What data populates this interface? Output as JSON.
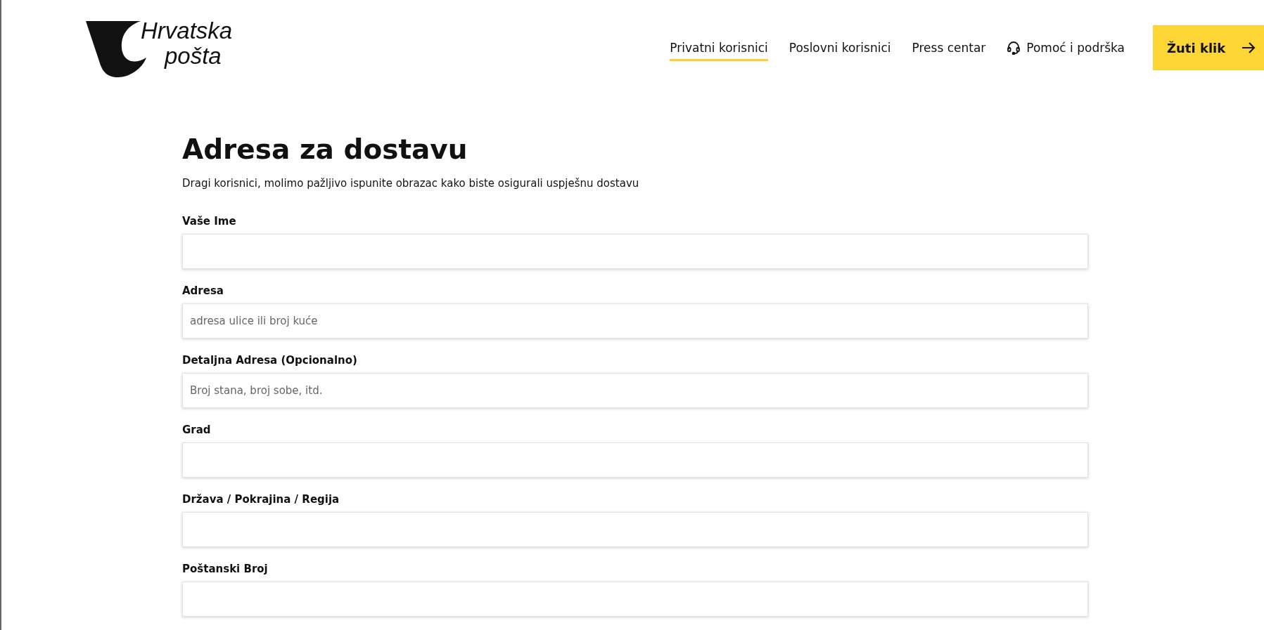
{
  "logo": {
    "line_1": "Hrvatska",
    "line_2": "pošta"
  },
  "nav": [
    {
      "label": "Privatni korisnici",
      "selected": true,
      "kind": "link"
    },
    {
      "label": "Poslovni korisnici",
      "selected": false,
      "kind": "link"
    },
    {
      "label": "Press centar",
      "selected": false,
      "kind": "link"
    },
    {
      "label": "Pomoć i podrška",
      "selected": false,
      "kind": "support"
    }
  ],
  "cta": {
    "label": "Žuti klik"
  },
  "heading": "Adresa za dostavu",
  "intro": "Dragi korisnici, molimo pažljivo ispunite obrazac kako biste osigurali uspješnu dostavu",
  "fields": [
    {
      "label": "Vaše Ime"
    },
    {
      "label": "Adresa",
      "placeholder": "adresa ulice ili broj kuće"
    },
    {
      "label": "Detaljna Adresa (Opcionalno)",
      "placeholder": "Broj stana, broj sobe, itd."
    },
    {
      "label": "Grad"
    },
    {
      "label": "Država / Pokrajina / Regija"
    },
    {
      "label": "Poštanski Broj"
    }
  ]
}
